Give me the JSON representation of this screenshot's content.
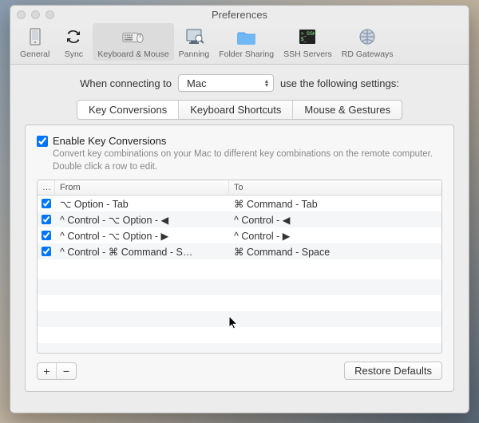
{
  "window": {
    "title": "Preferences"
  },
  "toolbar": {
    "items": [
      {
        "label": "General"
      },
      {
        "label": "Sync"
      },
      {
        "label": "Keyboard & Mouse"
      },
      {
        "label": "Panning"
      },
      {
        "label": "Folder Sharing"
      },
      {
        "label": "SSH Servers"
      },
      {
        "label": "RD Gateways"
      }
    ]
  },
  "connect": {
    "prefix": "When connecting to",
    "value": "Mac",
    "suffix": "use the following settings:"
  },
  "tabs": {
    "items": [
      {
        "label": "Key Conversions"
      },
      {
        "label": "Keyboard Shortcuts"
      },
      {
        "label": "Mouse & Gestures"
      }
    ]
  },
  "enable": {
    "title": "Enable Key Conversions",
    "desc": "Convert key combinations on your Mac to different key combinations on the remote computer. Double click a row to edit."
  },
  "table": {
    "headers": {
      "c0": "…",
      "c1": "From",
      "c2": "To"
    },
    "rows": [
      {
        "from": "⌥ Option - Tab",
        "to": "⌘ Command - Tab"
      },
      {
        "from": "^ Control - ⌥ Option - ◀",
        "to": "^ Control - ◀"
      },
      {
        "from": "^ Control - ⌥ Option - ▶",
        "to": "^ Control - ▶"
      },
      {
        "from": "^ Control - ⌘ Command - S…",
        "to": "⌘ Command - Space"
      }
    ]
  },
  "footer": {
    "add": "+",
    "remove": "−",
    "restore": "Restore Defaults"
  }
}
